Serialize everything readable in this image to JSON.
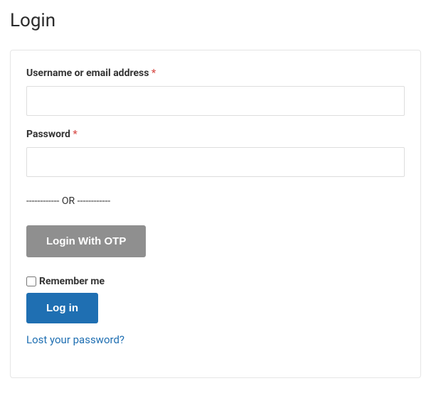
{
  "page": {
    "title": "Login"
  },
  "form": {
    "username": {
      "label": "Username or email address",
      "required_mark": "*",
      "value": ""
    },
    "password": {
      "label": "Password",
      "required_mark": "*",
      "value": ""
    },
    "or_divider": "------------ OR ------------",
    "otp_button": "Login With OTP",
    "remember": {
      "label": "Remember me",
      "checked": false
    },
    "login_button": "Log in",
    "lost_password": "Lost your password?"
  }
}
